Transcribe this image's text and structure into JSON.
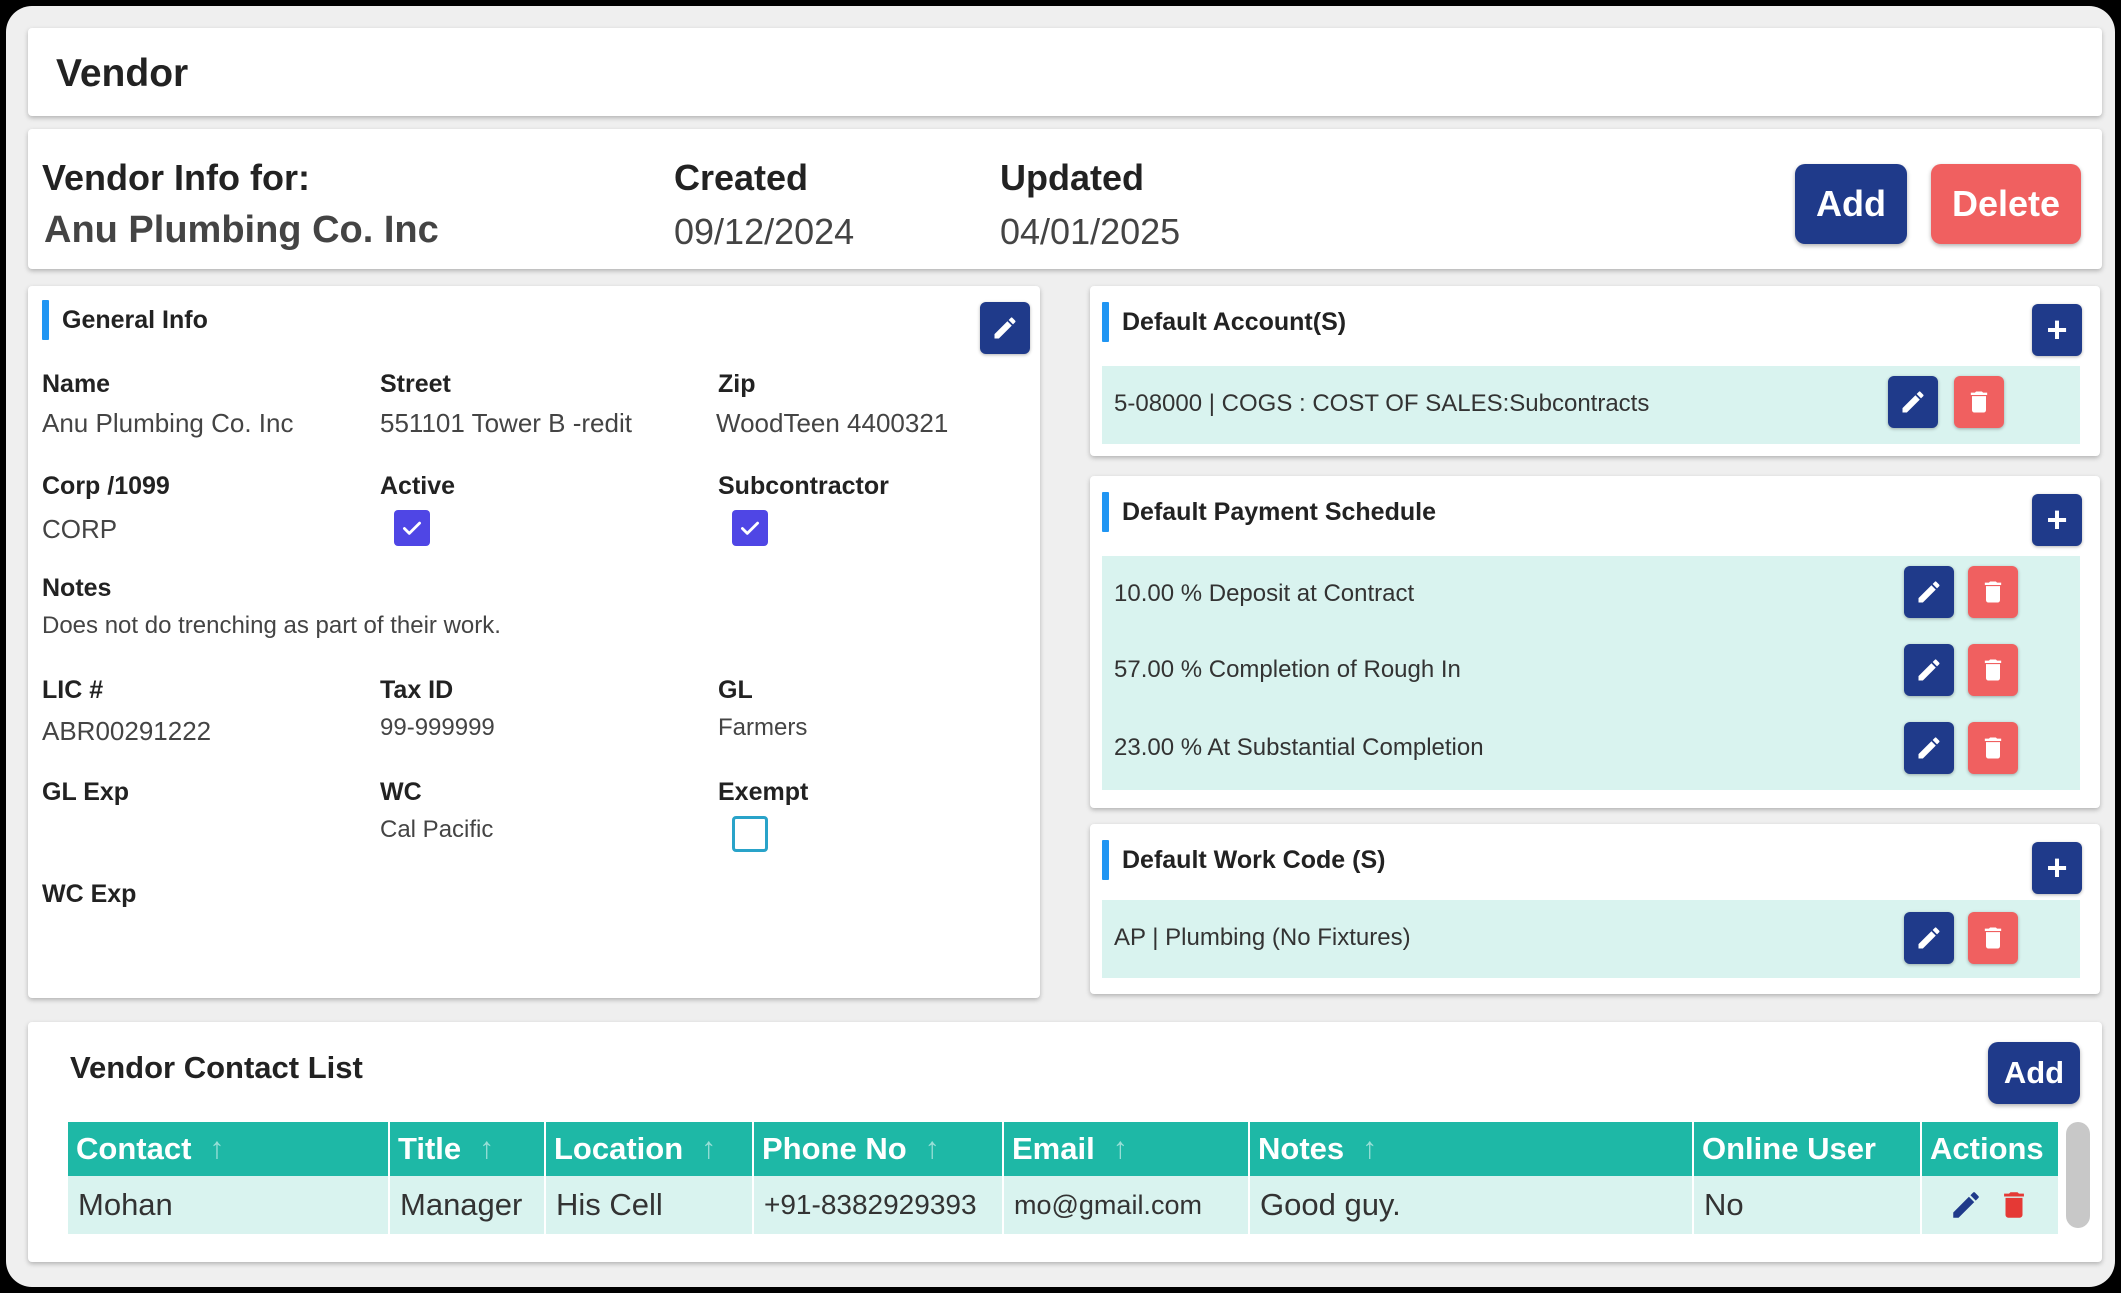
{
  "page": {
    "title": "Vendor"
  },
  "vendor_info": {
    "for_label": "Vendor Info for:",
    "vendor_name": "Anu Plumbing Co. Inc",
    "created_label": "Created",
    "created_value": "09/12/2024",
    "updated_label": "Updated",
    "updated_value": "04/01/2025",
    "add_label": "Add",
    "delete_label": "Delete"
  },
  "general_info": {
    "title": "General Info",
    "name_label": "Name",
    "name_value": "Anu Plumbing Co. Inc",
    "street_label": "Street",
    "street_value": "551101 Tower B -redit",
    "zip_label": "Zip",
    "zip_value": "WoodTeen 4400321",
    "corp_label": "Corp /1099",
    "corp_value": "CORP",
    "active_label": "Active",
    "active_checked": true,
    "subcontractor_label": "Subcontractor",
    "subcontractor_checked": true,
    "notes_label": "Notes",
    "notes_value": "Does not do trenching as part of their work.",
    "lic_label": "LIC #",
    "lic_value": "ABR00291222",
    "taxid_label": "Tax ID",
    "taxid_value": "99-999999",
    "gl_label": "GL",
    "gl_value": "Farmers",
    "glexp_label": "GL Exp",
    "wc_label": "WC",
    "wc_value": "Cal Pacific",
    "exempt_label": "Exempt",
    "exempt_checked": false,
    "wcexp_label": "WC Exp"
  },
  "default_accounts": {
    "title": "Default Account(S)",
    "items": [
      "5-08000 | COGS : COST OF SALES:Subcontracts"
    ]
  },
  "default_payment_schedule": {
    "title": "Default Payment Schedule",
    "items": [
      "10.00 % Deposit at Contract",
      "57.00 % Completion of Rough In",
      "23.00 % At Substantial Completion"
    ]
  },
  "default_work_codes": {
    "title": "Default Work Code (S)",
    "items": [
      "AP | Plumbing (No Fixtures)"
    ]
  },
  "contact_list": {
    "title": "Vendor Contact List",
    "add_label": "Add",
    "columns": [
      "Contact",
      "Title",
      "Location",
      "Phone No",
      "Email",
      "Notes",
      "Online User",
      "Actions"
    ],
    "rows": [
      {
        "contact": "Mohan",
        "title": "Manager",
        "location": "His Cell",
        "phone": "+91-8382929393",
        "email": "mo@gmail.com",
        "notes": "Good guy.",
        "online_user": "No"
      }
    ]
  },
  "colors": {
    "navy": "#1f3a8a",
    "red": "#f06060",
    "teal": "#1eb8a6",
    "band": "#d9f3ef",
    "accent_bar": "#2196f3",
    "checkbox": "#4f46e5"
  }
}
